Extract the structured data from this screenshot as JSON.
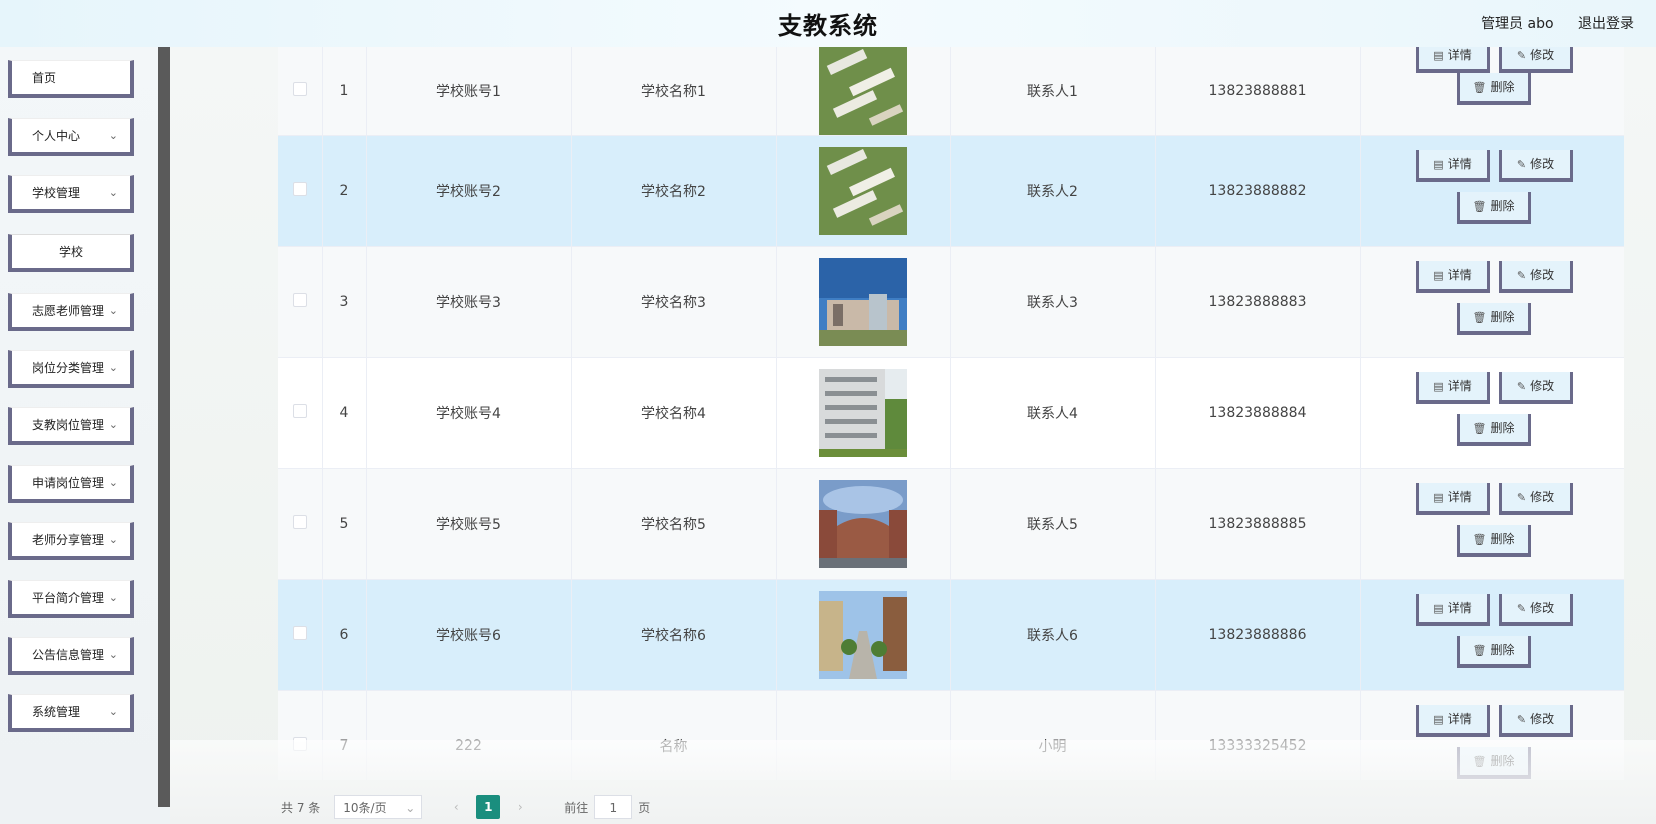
{
  "header": {
    "title": "支教系统",
    "user": "管理员 abo",
    "logout": "退出登录"
  },
  "sidebar": {
    "items": [
      {
        "label": "首页",
        "has_children": false
      },
      {
        "label": "个人中心",
        "has_children": true
      },
      {
        "label": "学校管理",
        "has_children": true
      },
      {
        "label": "学校",
        "has_children": false,
        "sub": true
      },
      {
        "label": "志愿老师管理",
        "has_children": true
      },
      {
        "label": "岗位分类管理",
        "has_children": true
      },
      {
        "label": "支教岗位管理",
        "has_children": true
      },
      {
        "label": "申请岗位管理",
        "has_children": true
      },
      {
        "label": "老师分享管理",
        "has_children": true
      },
      {
        "label": "平台简介管理",
        "has_children": true
      },
      {
        "label": "公告信息管理",
        "has_children": true
      },
      {
        "label": "系统管理",
        "has_children": true
      }
    ]
  },
  "table": {
    "rows": [
      {
        "index": "1",
        "account": "学校账号1",
        "name": "学校名称1",
        "image": "campus-aerial",
        "contact": "联系人1",
        "phone": "13823888881"
      },
      {
        "index": "2",
        "account": "学校账号2",
        "name": "学校名称2",
        "image": "campus-aerial",
        "contact": "联系人2",
        "phone": "13823888882"
      },
      {
        "index": "3",
        "account": "学校账号3",
        "name": "学校名称3",
        "image": "modern-building",
        "contact": "联系人3",
        "phone": "13823888883"
      },
      {
        "index": "4",
        "account": "学校账号4",
        "name": "学校名称4",
        "image": "classroom-block",
        "contact": "联系人4",
        "phone": "13823888884"
      },
      {
        "index": "5",
        "account": "学校账号5",
        "name": "学校名称5",
        "image": "courtyard",
        "contact": "联系人5",
        "phone": "13823888885"
      },
      {
        "index": "6",
        "account": "学校账号6",
        "name": "学校名称6",
        "image": "campus-walkway",
        "contact": "联系人6",
        "phone": "13823888886"
      },
      {
        "index": "7",
        "account": "222",
        "name": "名称",
        "image": "",
        "contact": "小明",
        "phone": "13333325452"
      }
    ],
    "actions": {
      "detail": "详情",
      "edit": "修改",
      "delete": "删除"
    }
  },
  "pagination": {
    "total_text": "共 7 条",
    "page_size": "10条/页",
    "current_page": "1",
    "goto_prefix": "前往",
    "goto_value": "1",
    "goto_suffix": "页"
  },
  "colors": {
    "accent": "#1a8e7e",
    "row_highlight": "#d8eefb",
    "button_border": "#6a6a8a"
  }
}
